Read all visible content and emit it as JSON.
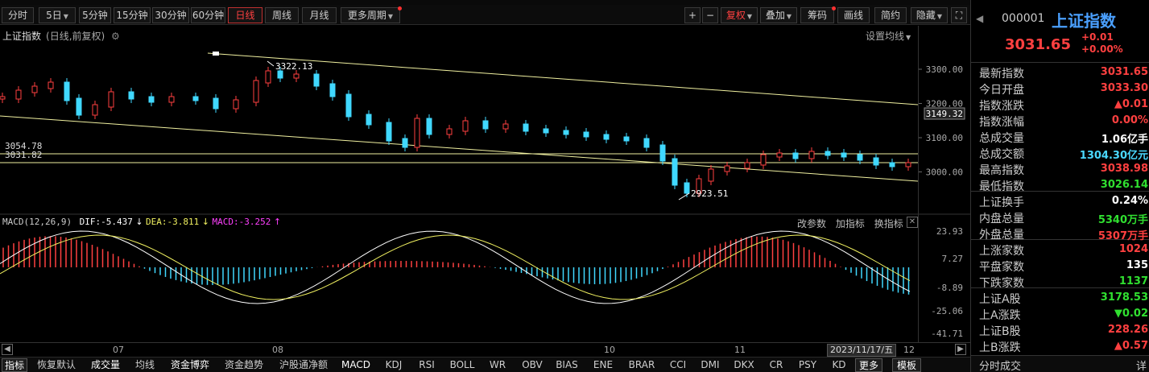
{
  "toolbar": {
    "periods": [
      "分时",
      "5日",
      "5分钟",
      "15分钟",
      "30分钟",
      "60分钟",
      "日线",
      "周线",
      "月线",
      "更多周期"
    ],
    "active_period": "日线",
    "plus": "+",
    "minus": "−",
    "fuquan": "复权",
    "diejia": "叠加",
    "chouma": "筹码",
    "huaxian": "画线",
    "jianyue": "简约",
    "yincang": "隐藏"
  },
  "chart": {
    "title": "上证指数",
    "subtitle": "(日线,前复权)",
    "settings_label": "设置均线",
    "y_labels": [
      "3300.00",
      "3200.00",
      "3100.00",
      "3000.00"
    ],
    "current_price_label": "3149.32",
    "hline_labels": [
      "3054.78",
      "3031.82"
    ],
    "annotation_high": "3322.13",
    "annotation_low": "2923.51"
  },
  "macd": {
    "name": "MACD(12,26,9)",
    "dif": "DIF:-5.437",
    "dea": "DEA:-3.811",
    "macd": "MACD:-3.252",
    "y_labels": [
      "23.93",
      "7.27",
      "-8.89",
      "-25.06",
      "-41.71"
    ],
    "actions": [
      "改参数",
      "加指标",
      "换指标"
    ]
  },
  "timeline": {
    "labels": [
      "07",
      "08",
      "10",
      "11",
      "12"
    ],
    "date_badge": "2023/11/17/五"
  },
  "indicators": [
    "指标",
    "恢复默认",
    "成交量",
    "均线",
    "资金博弈",
    "资金趋势",
    "沪股通净额",
    "MACD",
    "KDJ",
    "RSI",
    "BOLL",
    "WR",
    "OBV",
    "BIAS",
    "ENE",
    "BRAR",
    "CCI",
    "DMI",
    "DKX",
    "CR",
    "PSY",
    "KD",
    "更多",
    "模板"
  ],
  "quote": {
    "code": "000001",
    "name": "上证指数",
    "price": "3031.65",
    "change": "+0.01",
    "change_pct": "+0.00%",
    "rows": [
      {
        "label": "最新指数",
        "value": "3031.65",
        "color": "#ff4040"
      },
      {
        "label": "今日开盘",
        "value": "3033.30",
        "color": "#ff4040"
      },
      {
        "label": "指数涨跌",
        "value": "▲0.01",
        "color": "#ff4040"
      },
      {
        "label": "指数涨幅",
        "value": "0.00%",
        "color": "#ff4040"
      },
      {
        "label": "总成交量",
        "value": "1.06亿手",
        "color": "#ffffff"
      },
      {
        "label": "总成交额",
        "value": "1304.30亿元",
        "color": "#4ad8ff"
      },
      {
        "label": "最高指数",
        "value": "3038.98",
        "color": "#ff4040"
      },
      {
        "label": "最低指数",
        "value": "3026.14",
        "color": "#30e030"
      },
      {
        "label": "上证换手",
        "value": "0.24%",
        "color": "#ffffff"
      },
      {
        "label": "内盘总量",
        "value": "5340万手",
        "color": "#30e030"
      },
      {
        "label": "外盘总量",
        "value": "5307万手",
        "color": "#ff4040"
      },
      {
        "label": "上涨家数",
        "value": "1024",
        "color": "#ff4040"
      },
      {
        "label": "平盘家数",
        "value": "135",
        "color": "#ffffff"
      },
      {
        "label": "下跌家数",
        "value": "1137",
        "color": "#30e030"
      },
      {
        "label": "上证A股",
        "value": "3178.53",
        "color": "#30e030"
      },
      {
        "label": "上A涨跌",
        "value": "▼0.02",
        "color": "#30e030"
      },
      {
        "label": "上证B股",
        "value": "228.26",
        "color": "#ff4040"
      },
      {
        "label": "上B涨跌",
        "value": "▲0.57",
        "color": "#ff4040"
      }
    ],
    "footer": "分时成交",
    "footer_detail": "详"
  },
  "colors": {
    "up": "#ff4040",
    "down": "#40d8ff",
    "line": "#f0f0a0",
    "accent_blue": "#4aa0ff"
  }
}
